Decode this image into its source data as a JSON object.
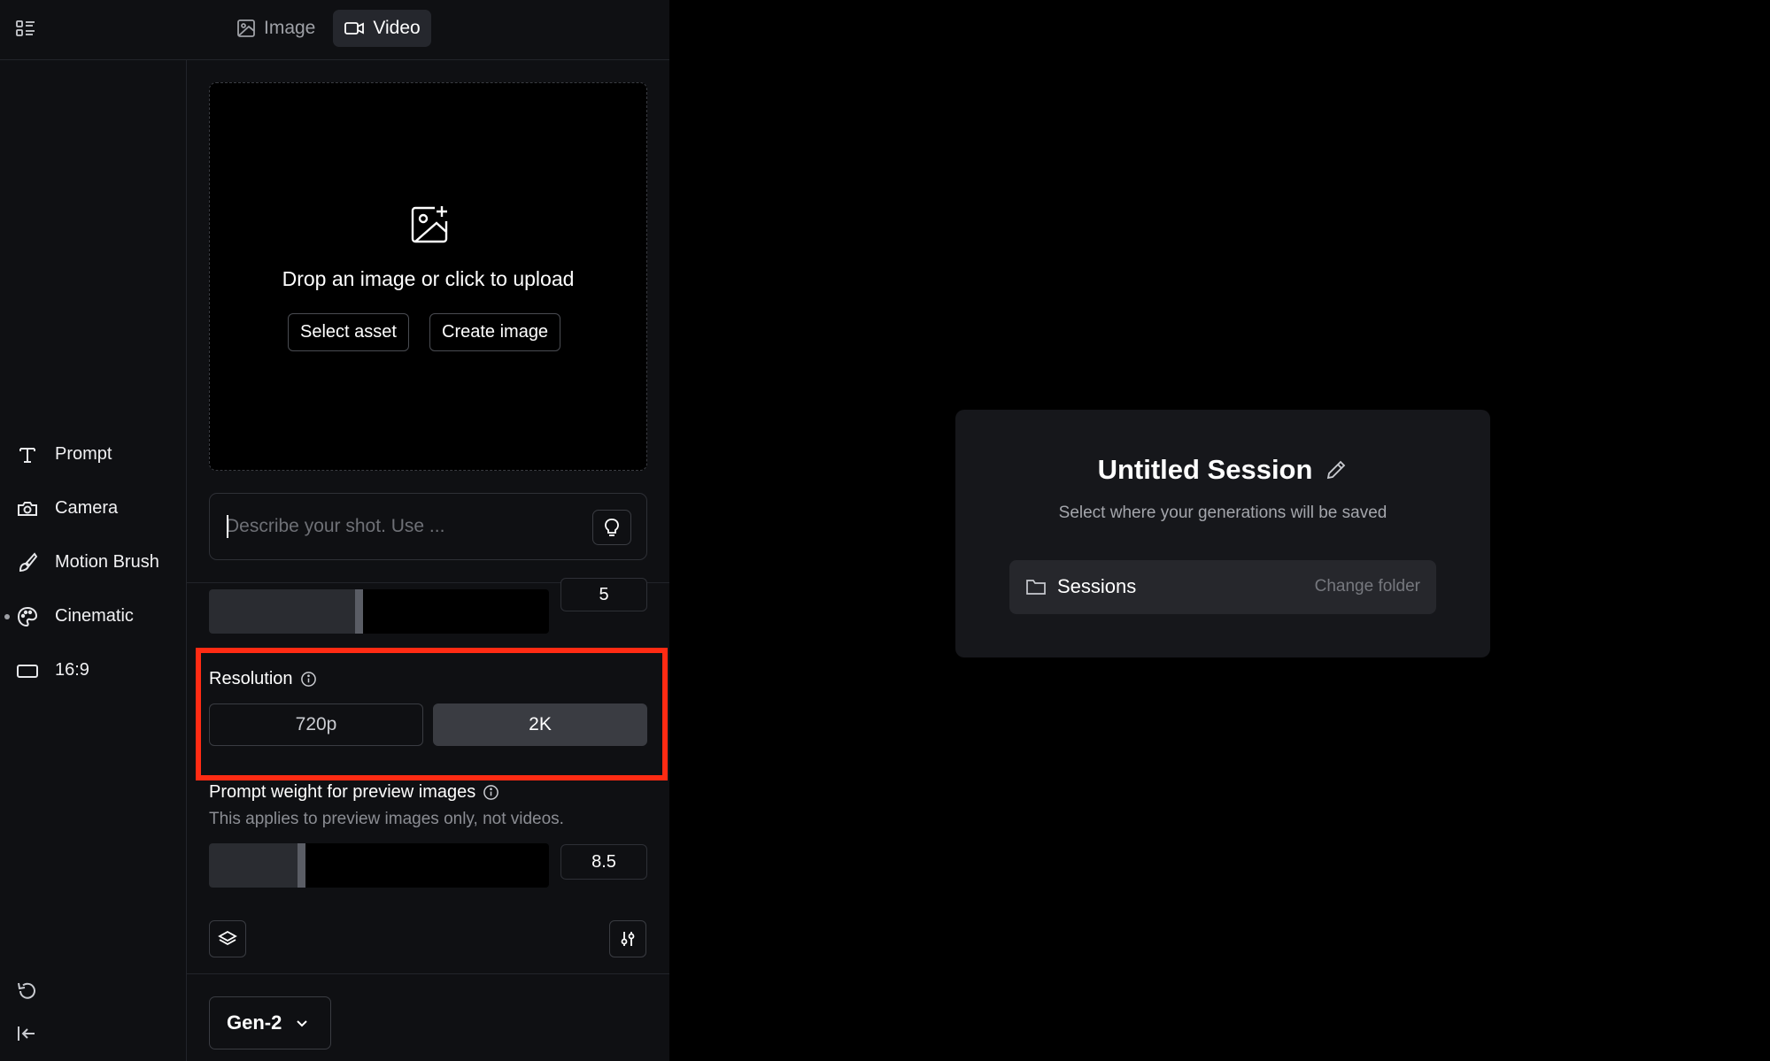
{
  "tabs": [
    {
      "label": "Image",
      "icon": "image-icon",
      "active": false
    },
    {
      "label": "Video",
      "icon": "video-camera-icon",
      "active": true
    }
  ],
  "sidebar": {
    "items": [
      {
        "label": "Prompt",
        "icon": "text-t-icon"
      },
      {
        "label": "Camera",
        "icon": "camera-icon"
      },
      {
        "label": "Motion Brush",
        "icon": "brush-icon"
      },
      {
        "label": "Cinematic",
        "icon": "palette-icon",
        "dot": true
      },
      {
        "label": "16:9",
        "icon": "aspect-ratio-icon"
      }
    ],
    "bottom_icons": [
      "undo-icon",
      "collapse-sidebar-icon"
    ]
  },
  "upload": {
    "text": "Drop an image or click to upload",
    "select_asset": "Select asset",
    "create_image": "Create image"
  },
  "prompt": {
    "placeholder": "Describe your shot. Use ..."
  },
  "duration": {
    "value": "5",
    "fraction": 0.44
  },
  "resolution": {
    "label": "Resolution",
    "options": [
      "720p",
      "2K"
    ],
    "selected": "2K"
  },
  "prompt_weight": {
    "label": "Prompt weight for preview images",
    "description": "This applies to preview images only, not videos.",
    "value": "8.5",
    "fraction": 0.27
  },
  "model": {
    "label": "Gen-2"
  },
  "session": {
    "title": "Untitled Session",
    "subtitle": "Select where your generations will be saved",
    "folder": "Sessions",
    "change_folder": "Change folder"
  },
  "colors": {
    "highlight": "#ff2b13",
    "panel_bg": "#0f1013",
    "card_bg": "#16171b"
  }
}
